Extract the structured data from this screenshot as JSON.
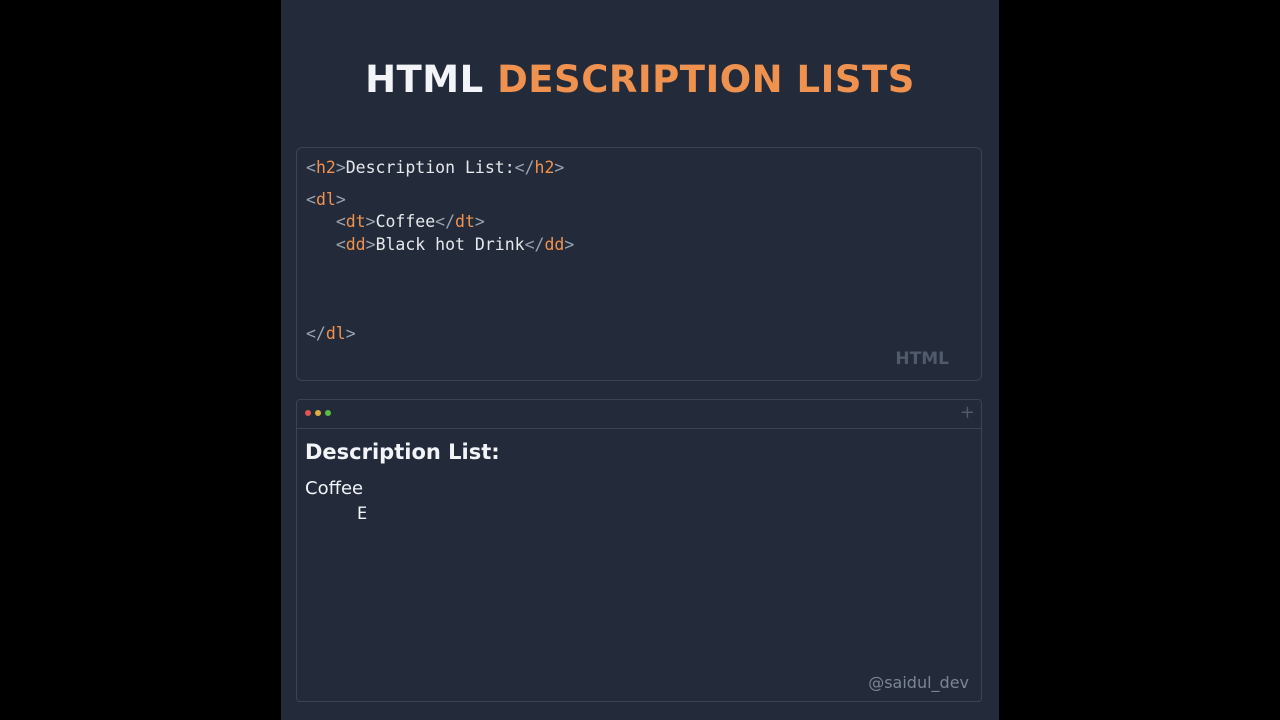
{
  "title": {
    "part1": "HTML",
    "part2": "DESCRIPTION LISTS"
  },
  "code": {
    "lines": [
      {
        "parts": [
          [
            "p",
            "<"
          ],
          [
            "t",
            "h2"
          ],
          [
            "p",
            ">"
          ],
          [
            "tx",
            "Description List:"
          ],
          [
            "p",
            "</"
          ],
          [
            "t",
            "h2"
          ],
          [
            "p",
            ">"
          ]
        ]
      },
      {
        "parts": [
          [
            "p",
            "<"
          ],
          [
            "t",
            "dl"
          ],
          [
            "p",
            ">"
          ]
        ]
      },
      {
        "parts": [
          [
            "tx",
            "   "
          ],
          [
            "p",
            "<"
          ],
          [
            "t",
            "dt"
          ],
          [
            "p",
            ">"
          ],
          [
            "tx",
            "Coffee"
          ],
          [
            "p",
            "</"
          ],
          [
            "t",
            "dt"
          ],
          [
            "p",
            ">"
          ]
        ]
      },
      {
        "parts": [
          [
            "tx",
            "   "
          ],
          [
            "p",
            "<"
          ],
          [
            "t",
            "dd"
          ],
          [
            "p",
            ">"
          ],
          [
            "tx",
            "Black hot Drink"
          ],
          [
            "p",
            "</"
          ],
          [
            "t",
            "dd"
          ],
          [
            "p",
            ">"
          ]
        ]
      },
      {
        "parts": [
          [
            "p",
            "</"
          ],
          [
            "t",
            "dl"
          ],
          [
            "p",
            ">"
          ]
        ]
      }
    ],
    "language": "HTML"
  },
  "preview": {
    "heading": "Description List:",
    "dt": "Coffee",
    "dd": "E",
    "plus_icon": "+"
  },
  "watermark": "@saidul_dev",
  "colors": {
    "background": "#232b3a",
    "accent": "#f0924f",
    "dot_red": "#e2544e",
    "dot_yellow": "#dfb13c",
    "dot_green": "#57c041"
  }
}
